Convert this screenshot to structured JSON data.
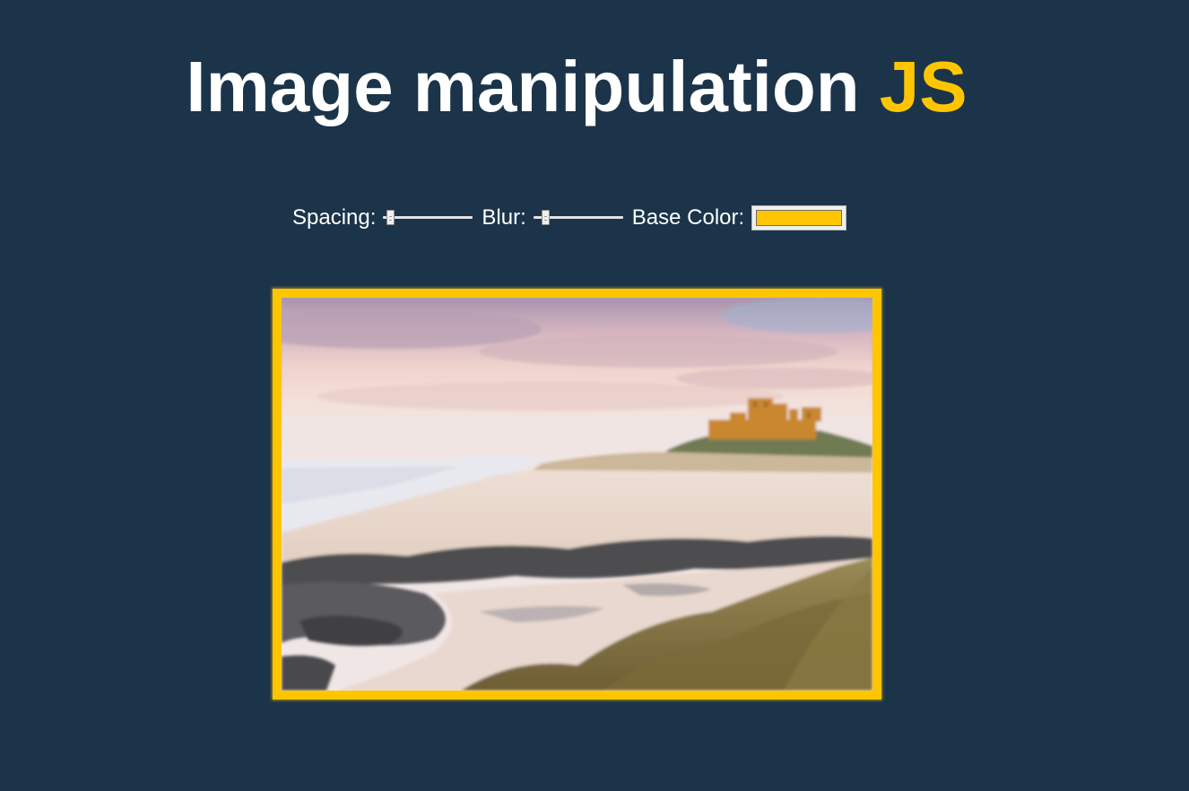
{
  "page": {
    "title_main": "Image manipulation ",
    "title_accent": "JS"
  },
  "controls": {
    "spacing": {
      "label": "Spacing:",
      "value_fraction": 0.04
    },
    "blur": {
      "label": "Blur:",
      "value_fraction": 0.1
    },
    "base_color": {
      "label": "Base Color:",
      "value": "#ffc600"
    }
  },
  "photo": {
    "description_icon": "landscape-photo"
  },
  "colors": {
    "background": "#1b344a",
    "accent": "#ffc600",
    "text": "#ffffff"
  }
}
